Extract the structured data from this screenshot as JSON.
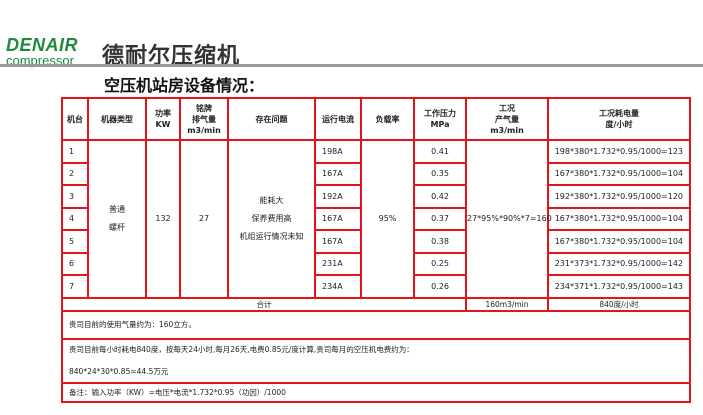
{
  "brand": {
    "name_en": "DENAIR",
    "sub_en": "compressor",
    "name_cn": "德耐尔压缩机"
  },
  "title": "空压机站房设备情况：",
  "table": {
    "headers": {
      "unit": "机台",
      "type": "机器类型",
      "power": [
        "功率",
        "KW"
      ],
      "flow": [
        "铭牌",
        "排气量",
        "m3/min"
      ],
      "issues": "存在问题",
      "current": "运行电流",
      "load": "负载率",
      "pressure": [
        "工作压力",
        "MPa"
      ],
      "actual_flow": [
        "工况",
        "产气量",
        "m3/min"
      ],
      "energy": [
        "工况耗电量",
        "度/小时"
      ]
    },
    "shared": {
      "type": [
        "普通",
        "螺杆"
      ],
      "power": "132",
      "flow": "27",
      "issues": [
        "能耗大",
        "保养费用高",
        "机组运行情况未知"
      ],
      "load": "95%",
      "actual_flow": "27*95%*90%*7=160"
    },
    "rows": [
      {
        "unit": "1",
        "current": "198A",
        "pressure": "0.41",
        "energy": "198*380*1.732*0.95/1000=123"
      },
      {
        "unit": "2",
        "current": "167A",
        "pressure": "0.35",
        "energy": "167*380*1.732*0.95/1000=104"
      },
      {
        "unit": "3",
        "current": "192A",
        "pressure": "0.42",
        "energy": "192*380*1.732*0.95/1000=120"
      },
      {
        "unit": "4",
        "current": "167A",
        "pressure": "0.37",
        "energy": "167*380*1.732*0.95/1000=104"
      },
      {
        "unit": "5",
        "current": "167A",
        "pressure": "0.38",
        "energy": "167*380*1.732*0.95/1000=104"
      },
      {
        "unit": "6",
        "current": "231A",
        "pressure": "0.25",
        "energy": "231*373*1.732*0.95/1000=142"
      },
      {
        "unit": "7",
        "current": "234A",
        "pressure": "0.26",
        "energy": "234*371*1.732*0.95/1000=143"
      }
    ],
    "total": {
      "label": "合计",
      "flow": "160m3/min",
      "energy": "840度/小时"
    },
    "notes": {
      "usage": "贵司目前的使用气量约为：160立方。",
      "cost_line1": "贵司目前每小时耗电840度，按每天24小时,每月26天,电费0.85元/度计算,贵司每月的空压机电费约为：",
      "cost_line2": "840*24*30*0.85=44.5万元",
      "remark": "备注：输入功率（KW）=电压*电流*1.732*0.95（功因）/1000"
    }
  }
}
